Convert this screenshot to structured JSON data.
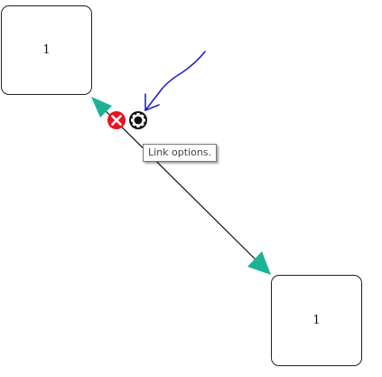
{
  "nodes": [
    {
      "label": "1"
    },
    {
      "label": "1"
    }
  ],
  "link": {
    "tooltip": "Link options.",
    "icons": {
      "remove": "remove-link-icon",
      "options": "gear-icon"
    }
  },
  "annotation": {
    "icon": "hand-drawn-arrow-icon"
  },
  "colors": {
    "arrowhead": "#1ab394",
    "remove": "#e8121f",
    "gear": "#111111",
    "annotation": "#1f22cc",
    "line": "#111111"
  }
}
